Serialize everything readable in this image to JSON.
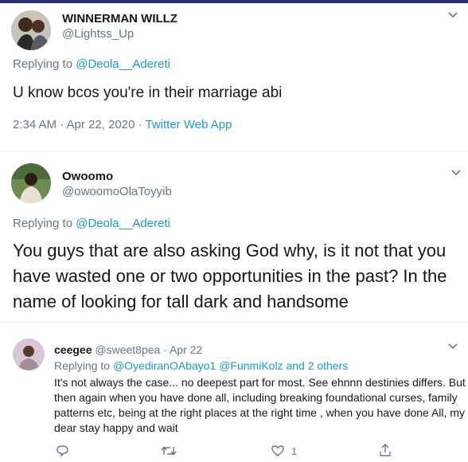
{
  "tweet1": {
    "name": "WINNERMAN WILLZ",
    "handle": "@Lightss_Up",
    "replying_prefix": "Replying to ",
    "replying_to": "@Deola__Adereti",
    "text": "U know bcos you're in their marriage abi",
    "timestamp": "2:34 AM · Apr 22, 2020 · ",
    "source": "Twitter Web App"
  },
  "tweet2": {
    "name": "Owoomo",
    "handle": "@owoomoOlaToyyib",
    "replying_prefix": "Replying to ",
    "replying_to": "@Deola__Adereti",
    "text": "You guys that are also asking God why, is it not that you have wasted one or two opportunities in the past? In the name of looking for tall dark and handsome"
  },
  "tweet3": {
    "name": "ceegee",
    "handle_date": "@sweet8pea · Apr 22",
    "replying_prefix": "Replying to ",
    "replying_to": "@OyediranOAbayo1 @FunmiKolz and 2 others",
    "text": "It's not always the case... no deepest part for most. See ehnnn destinies differs. But then again when you have done all, including breaking foundational curses, family patterns etc, being at the right places at the right time , when you have done All, my dear stay happy and wait",
    "like_count": "1"
  },
  "icons": {
    "chevron": "chevron-down-icon",
    "reply": "reply-icon",
    "retweet": "retweet-icon",
    "like": "heart-icon",
    "share": "share-icon"
  },
  "colors": {
    "link": "#1b95e0",
    "secondary_text": "#657786",
    "divider": "#e6ecf0",
    "top_bar": "#2b2f7a"
  }
}
